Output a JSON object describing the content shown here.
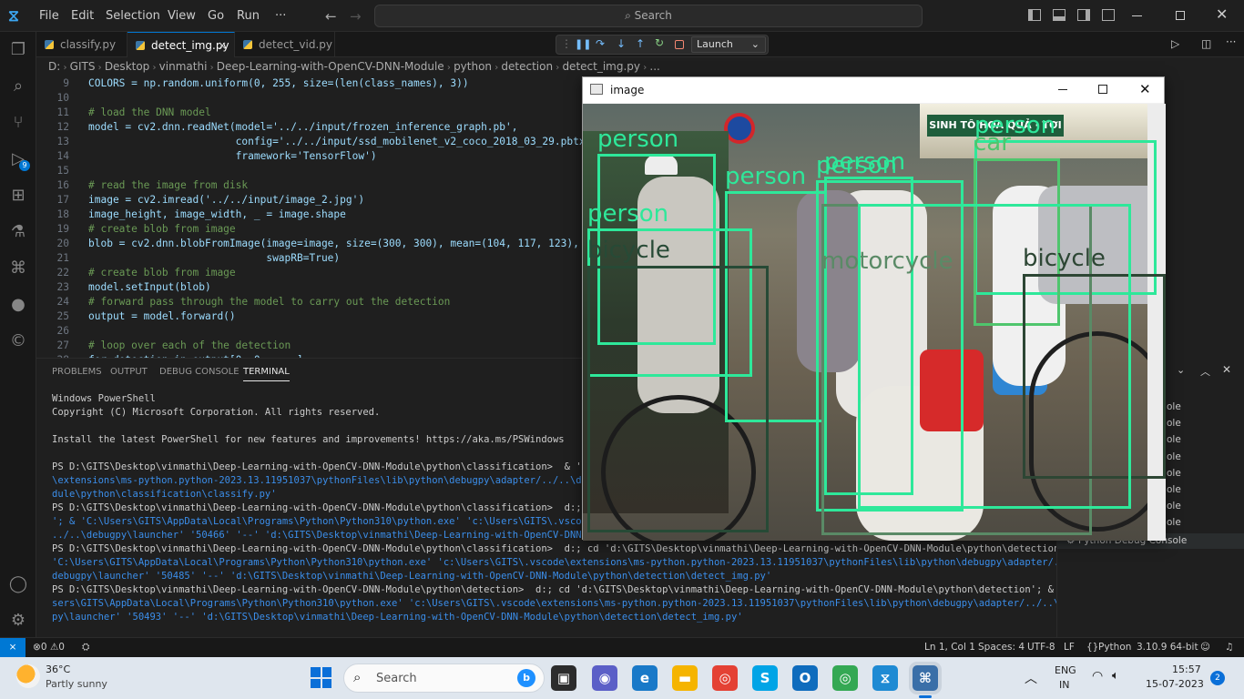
{
  "app": {
    "menu": [
      "File",
      "Edit",
      "Selection",
      "View",
      "Go",
      "Run"
    ],
    "more": "···",
    "search_placeholder": "Search"
  },
  "tabs": [
    "classify.py",
    "detect_img.py",
    "detect_vid.py"
  ],
  "debug": {
    "config": "Launch"
  },
  "breadcrumb": [
    "D:",
    "GITS",
    "Desktop",
    "vinmathi",
    "Deep-Learning-with-OpenCV-DNN-Module",
    "python",
    "detection",
    "detect_img.py",
    "..."
  ],
  "editor": {
    "lines": [
      {
        "n": "9",
        "t": "COLORS = np.random.uniform(0, 255, size=(len(class_names), 3))"
      },
      {
        "n": "10",
        "t": ""
      },
      {
        "n": "11",
        "t": "# load the DNN model"
      },
      {
        "n": "12",
        "t": "model = cv2.dnn.readNet(model='../../input/frozen_inference_graph.pb',"
      },
      {
        "n": "13",
        "t": "                        config='../../input/ssd_mobilenet_v2_coco_2018_03_29.pbtxt.txt',"
      },
      {
        "n": "14",
        "t": "                        framework='TensorFlow')"
      },
      {
        "n": "15",
        "t": ""
      },
      {
        "n": "16",
        "t": "# read the image from disk"
      },
      {
        "n": "17",
        "t": "image = cv2.imread('../../input/image_2.jpg')"
      },
      {
        "n": "18",
        "t": "image_height, image_width, _ = image.shape"
      },
      {
        "n": "19",
        "t": "# create blob from image"
      },
      {
        "n": "20",
        "t": "blob = cv2.dnn.blobFromImage(image=image, size=(300, 300), mean=(104, 117, 123),"
      },
      {
        "n": "21",
        "t": "                             swapRB=True)"
      },
      {
        "n": "22",
        "t": "# create blob from image"
      },
      {
        "n": "23",
        "t": "model.setInput(blob)"
      },
      {
        "n": "24",
        "t": "# forward pass through the model to carry out the detection"
      },
      {
        "n": "25",
        "t": "output = model.forward()"
      },
      {
        "n": "26",
        "t": ""
      },
      {
        "n": "27",
        "t": "# loop over each of the detection"
      },
      {
        "n": "28",
        "t": "for detection in output[0, 0, :, :]:"
      }
    ]
  },
  "panel": {
    "tabs": [
      "PROBLEMS",
      "OUTPUT",
      "DEBUG CONSOLE",
      "TERMINAL"
    ]
  },
  "terminal": {
    "lines": [
      "Windows PowerShell",
      "Copyright (C) Microsoft Corporation. All rights reserved.",
      "",
      "Install the latest PowerShell for new features and improvements! https://aka.ms/PSWindows",
      "",
      "PS D:\\GITS\\Desktop\\vinmathi\\Deep-Learning-with-OpenCV-DNN-Module\\python\\classification>  & 'C:\\Users\\GITS\\AppData\\Local\\Programs\\Python\\Python310\\python.exe' 'c:\\Users\\GITS\\.vscode",
      "\\extensions\\ms-python.python-2023.13.11951037\\pythonFiles\\lib\\python\\debugpy\\adapter/../..\\debugpy\\launcher' '50452' '--' 'D:\\GITS\\Desktop\\vinmathi\\Deep-Learning-with-OpenCV-DNN-Mo",
      "dule\\python\\classification\\classify.py'",
      "PS D:\\GITS\\Desktop\\vinmathi\\Deep-Learning-with-OpenCV-DNN-Module\\python\\classification>  d:; cd 'd:\\GITS\\Desktop\\vinmathi\\Deep-Learning-with-OpenCV-DNN-Module\\python\\detection'",
      "'; & 'C:\\Users\\GITS\\AppData\\Local\\Programs\\Python\\Python310\\python.exe' 'c:\\Users\\GITS\\.vscode\\extensions\\ms-python.python-2023.13.11951037\\pythonFiles\\lib\\python\\debugpy\\adapter/",
      "../..\\debugpy\\launcher' '50466' '--' 'd:\\GITS\\Desktop\\vinmathi\\Deep-Learning-with-OpenCV-DNN-Module\\python\\detection\\detect_img.py'",
      "PS D:\\GITS\\Desktop\\vinmathi\\Deep-Learning-with-OpenCV-DNN-Module\\python\\classification>  d:; cd 'd:\\GITS\\Desktop\\vinmathi\\Deep-Learning-with-OpenCV-DNN-Module\\python\\detection'; &",
      "'C:\\Users\\GITS\\AppData\\Local\\Programs\\Python\\Python310\\python.exe' 'c:\\Users\\GITS\\.vscode\\extensions\\ms-python.python-2023.13.11951037\\pythonFiles\\lib\\python\\debugpy\\adapter/../..\\",
      "debugpy\\launcher' '50485' '--' 'd:\\GITS\\Desktop\\vinmathi\\Deep-Learning-with-OpenCV-DNN-Module\\python\\detection\\detect_img.py'",
      "PS D:\\GITS\\Desktop\\vinmathi\\Deep-Learning-with-OpenCV-DNN-Module\\python\\detection>  d:; cd 'd:\\GITS\\Desktop\\vinmathi\\Deep-Learning-with-OpenCV-DNN-Module\\python\\detection'; & 'C:\\U",
      "sers\\GITS\\AppData\\Local\\Programs\\Python\\Python310\\python.exe' 'c:\\Users\\GITS\\.vscode\\extensions\\ms-python.python-2023.13.11951037\\pythonFiles\\lib\\python\\debugpy\\adapter/../..\\debug",
      "py\\launcher' '50493' '--' 'd:\\GITS\\Desktop\\vinmathi\\Deep-Learning-with-OpenCV-DNN-Module\\python\\detection\\detect_img.py'"
    ]
  },
  "right_panel": {
    "items": [
      "ole",
      "ole",
      "ole",
      "ole",
      "ole",
      "ole",
      "ole",
      "ole"
    ],
    "last": "Python Debug Console"
  },
  "status": {
    "errors": "0",
    "warnings": "0",
    "position": "Ln 1, Col 1",
    "spaces": "Spaces: 4",
    "encoding": "UTF-8",
    "eol": "LF",
    "language": "Python",
    "interpreter": "3.10.9 64-bit"
  },
  "image_window": {
    "title": "image",
    "detections": [
      {
        "label": "person",
        "color": "#2ee89a"
      },
      {
        "label": "person",
        "color": "#2ee89a"
      },
      {
        "label": "person",
        "color": "#2ee89a"
      },
      {
        "label": "person",
        "color": "#2ee89a"
      },
      {
        "label": "person",
        "color": "#2ee89a"
      },
      {
        "label": "person",
        "color": "#2ee89a"
      },
      {
        "label": "bicycle",
        "color": "#274a36"
      },
      {
        "label": "motorcycle",
        "color": "#5a8a66"
      },
      {
        "label": "car",
        "color": "#4fc56d"
      },
      {
        "label": "bicycle",
        "color": "#2d4634"
      }
    ],
    "sign_text": "SINH TÔ HOA QUẢ · TƠI"
  },
  "taskbar": {
    "temp": "36°C",
    "weather": "Partly sunny",
    "search": "Search",
    "lang1": "ENG",
    "lang2": "IN",
    "time": "15:57",
    "date": "15-07-2023",
    "notif": "2"
  }
}
